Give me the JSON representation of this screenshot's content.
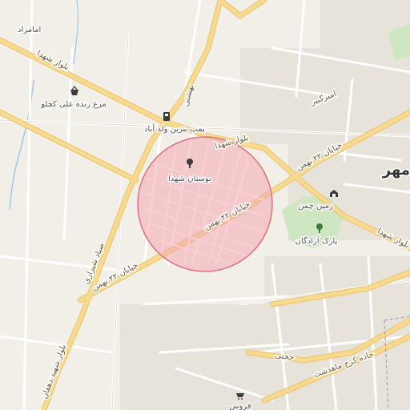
{
  "map": {
    "colors": {
      "background": "#f2efe9",
      "major_road": "#f7d98f",
      "major_road_casing": "#e9c46a",
      "minor_road": "#ffffff",
      "minor_road_casing": "#d9d4cc",
      "park": "#cfe6c3",
      "water": "#9ec7e8",
      "radius_fill": "#f4a7b0",
      "radius_stroke": "#e26f7f",
      "block": "#e4e0d8"
    },
    "highlight": {
      "shape": "circle",
      "center_label": "بوستان شهدا"
    },
    "roads": {
      "blvd_shohada_nw": "بلوار شهدا",
      "blvd_shohada_mid": "بلوار شهدا",
      "blvd_shohada_se": "بلوار شهدا",
      "bahman_22_a": "خیابان ۲۲ بهمن",
      "bahman_22_b": "خیابان ۲۲ بهمن",
      "bahman_22_c": "خیابان ۲۲ بهمن",
      "sayad": "صیاد شیرازی",
      "dehghan": "بلوار شهید دهقان",
      "beheshti": "بهشتی",
      "amir_kabir": "امیرکبیر",
      "hojjati": "حجتی",
      "karaj_road": "جاده کرج ماهدشت"
    },
    "pois": [
      {
        "label": "بوستان شهدا",
        "icon": "park-tree-icon"
      },
      {
        "label": "پمپ بنزین ولد آباد",
        "icon": "fuel-pump-icon"
      },
      {
        "label": "مرغ زنده علی کچلو",
        "icon": "shopping-basket-icon"
      },
      {
        "label": "زمین چمن",
        "icon": "stadium-icon"
      },
      {
        "label": "پارک آزادگان",
        "icon": "park-tree-icon"
      },
      {
        "label": "امامزاد",
        "icon": ""
      },
      {
        "label": "فروش",
        "icon": "shopping-cart-icon"
      }
    ],
    "district_label": "مهر"
  }
}
